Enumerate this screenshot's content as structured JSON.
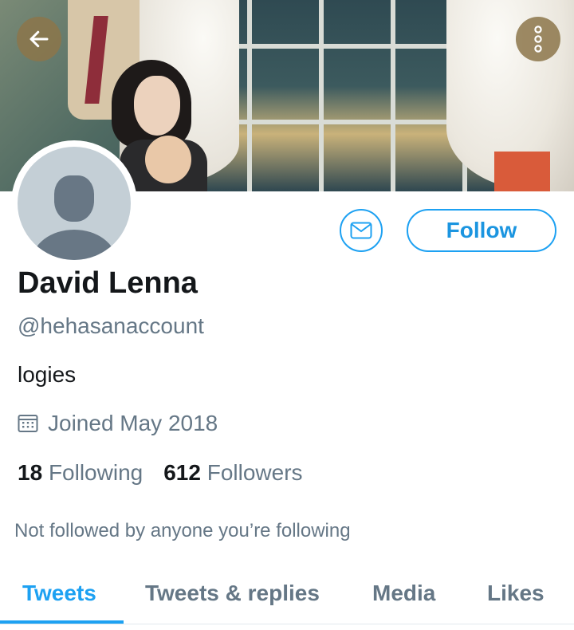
{
  "header": {
    "back_icon": "arrow-left-icon",
    "more_icon": "more-vertical-icon"
  },
  "profile": {
    "name": "David Lenna",
    "handle": "@hehasanaccount",
    "bio": "logies",
    "joined": "Joined May 2018",
    "joined_icon": "calendar-icon",
    "following_count": "18",
    "following_label": "Following",
    "followers_count": "612",
    "followers_label": "Followers",
    "followed_by": "Not followed by anyone you’re following"
  },
  "actions": {
    "message_icon": "envelope-icon",
    "follow_label": "Follow"
  },
  "tabs": [
    {
      "label": "Tweets",
      "active": true
    },
    {
      "label": "Tweets & replies",
      "active": false
    },
    {
      "label": "Media",
      "active": false
    },
    {
      "label": "Likes",
      "active": false
    }
  ],
  "colors": {
    "accent": "#1da1f2",
    "text_primary": "#14171a",
    "text_secondary": "#657786",
    "avatar_bg": "#c4cfd6",
    "overlay_button": "#8c764a"
  }
}
